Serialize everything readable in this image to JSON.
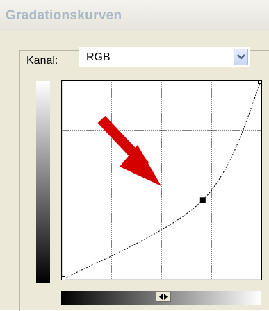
{
  "dialog": {
    "title": "Gradationskurven"
  },
  "channel": {
    "label": "Kanal:",
    "selected": "RGB",
    "dropdown_icon": "chevron-down-icon"
  },
  "curve": {
    "grid_divisions": 4,
    "input_range": [
      0,
      255
    ],
    "output_range": [
      0,
      255
    ],
    "control_points": [
      {
        "input": 0,
        "output": 0
      },
      {
        "input": 180,
        "output": 102
      },
      {
        "input": 255,
        "output": 255
      }
    ]
  },
  "annotation": {
    "arrow_color": "#d40000",
    "icon": "red-arrow-icon"
  },
  "gradient_toggle_icon": "left-right-arrows-icon"
}
